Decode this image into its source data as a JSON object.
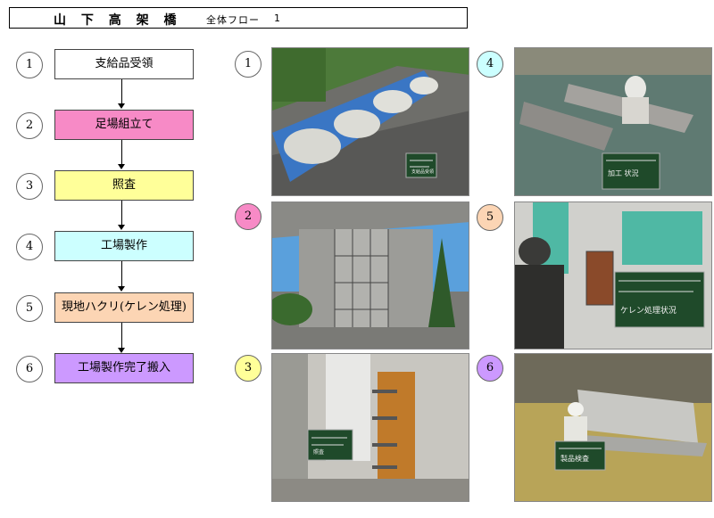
{
  "header": {
    "title": "山 下 高 架 橋",
    "subtitle": "全体フロー",
    "page": "1"
  },
  "colors": {
    "step1": "#ffffff",
    "step2": "#f78ac6",
    "step3": "#ffff99",
    "step4": "#ccffff",
    "step5": "#fcd5b4",
    "step6": "#cc99ff"
  },
  "flow": {
    "steps": [
      {
        "num": "1",
        "label": "支給品受領"
      },
      {
        "num": "2",
        "label": "足場組立て"
      },
      {
        "num": "3",
        "label": "照査"
      },
      {
        "num": "4",
        "label": "工場製作"
      },
      {
        "num": "5",
        "label": "現地ハクリ(ケレン処理)"
      },
      {
        "num": "6",
        "label": "工場製作完了搬入"
      }
    ]
  },
  "photos": [
    {
      "num": "1",
      "icon": "material-delivery-photo",
      "board": [
        "支給品受領"
      ]
    },
    {
      "num": "2",
      "icon": "scaffolding-photo",
      "board": []
    },
    {
      "num": "3",
      "icon": "inspection-photo",
      "board": [
        "照査"
      ]
    },
    {
      "num": "4",
      "icon": "welding-photo",
      "board": [
        "加工 状況"
      ]
    },
    {
      "num": "5",
      "icon": "blasting-photo",
      "board": [
        "ケレン処理状況"
      ]
    },
    {
      "num": "6",
      "icon": "finished-product-photo",
      "board": [
        "製品検査"
      ]
    }
  ]
}
